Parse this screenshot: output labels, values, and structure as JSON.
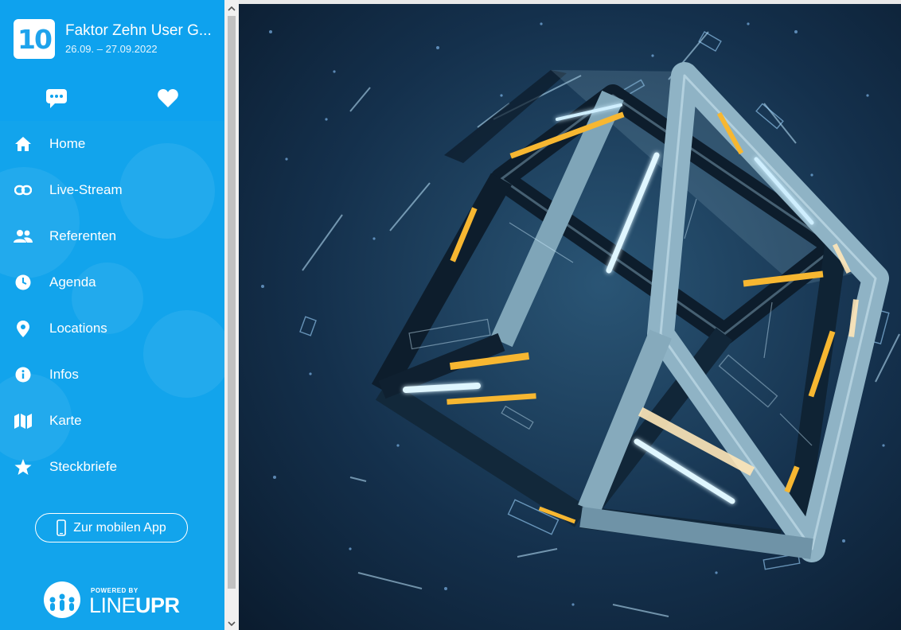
{
  "event": {
    "logo_text": "10",
    "title": "Faktor Zehn User G...",
    "dates": "26.09. – 27.09.2022"
  },
  "header_icons": [
    "chat-icon",
    "heart-icon"
  ],
  "nav": {
    "items": [
      {
        "label": "Home",
        "icon": "home-icon"
      },
      {
        "label": "Live-Stream",
        "icon": "link-icon"
      },
      {
        "label": "Referenten",
        "icon": "people-icon"
      },
      {
        "label": "Agenda",
        "icon": "clock-icon"
      },
      {
        "label": "Locations",
        "icon": "location-pin-icon"
      },
      {
        "label": "Infos",
        "icon": "info-icon"
      },
      {
        "label": "Karte",
        "icon": "map-icon"
      },
      {
        "label": "Steckbriefe",
        "icon": "star-icon"
      }
    ]
  },
  "mobile_button": {
    "label": "Zur mobilen App",
    "icon": "phone-icon"
  },
  "powered": {
    "small": "POWERED BY",
    "brand_light": "LINE",
    "brand_bold": "UPR"
  },
  "colors": {
    "sidebar": "#12a4ec",
    "accent_yellow": "#f7b731",
    "background": "#0d2238"
  }
}
